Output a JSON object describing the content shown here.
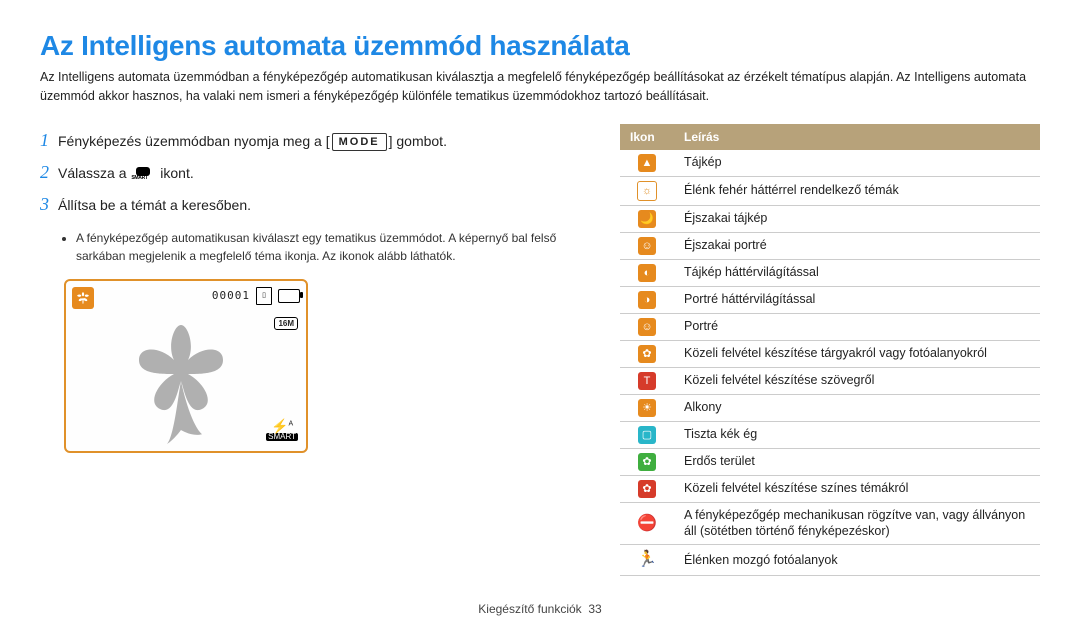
{
  "title": "Az Intelligens automata üzemmód használata",
  "intro": "Az Intelligens automata üzemmódban a fényképezőgép automatikusan kiválasztja a megfelelő fényképezőgép beállításokat az érzékelt tématípus alapján. Az Intelligens automata üzemmód akkor hasznos, ha valaki nem ismeri a fényképezőgép különféle tematikus üzemmódokhoz tartozó beállításait.",
  "steps": {
    "s1_a": "Fényképezés üzemmódban nyomja meg a [",
    "mode": "MODE",
    "s1_b": "] gombot.",
    "s2_a": "Válassza a ",
    "s2_b": " ikont.",
    "s3": "Állítsa be a témát a keresőben."
  },
  "bullet": "A fényképezőgép automatikusan kiválaszt egy tematikus üzemmódot. A képernyő bal felső sarkában megjelenik a megfelelő téma ikonja. Az ikonok alább láthatók.",
  "screen": {
    "counter": "00001",
    "res": "16M",
    "flash_sub": "SMART"
  },
  "th_icon": "Ikon",
  "th_desc": "Leírás",
  "rows": [
    {
      "c": "#e68a1e",
      "sym": "▲",
      "d": "Tájkép"
    },
    {
      "c": "#ffffff",
      "sym": "☼",
      "d": "Élénk fehér háttérrel rendelkező témák",
      "bd": "#e0912a",
      "fg": "#e0912a"
    },
    {
      "c": "#e68a1e",
      "sym": "🌙",
      "d": "Éjszakai tájkép"
    },
    {
      "c": "#e68a1e",
      "sym": "☺",
      "d": "Éjszakai portré"
    },
    {
      "c": "#e68a1e",
      "sym": "◐",
      "d": "Tájkép háttérvilágítással"
    },
    {
      "c": "#e68a1e",
      "sym": "◑",
      "d": "Portré háttérvilágítással"
    },
    {
      "c": "#e68a1e",
      "sym": "☺",
      "d": "Portré"
    },
    {
      "c": "#e68a1e",
      "sym": "✿",
      "d": "Közeli felvétel készítése tárgyakról vagy fotóalanyokról"
    },
    {
      "c": "#d63b2a",
      "sym": "T",
      "d": "Közeli felvétel készítése szövegről"
    },
    {
      "c": "#e68a1e",
      "sym": "☀",
      "d": "Alkony"
    },
    {
      "c": "#29b6c9",
      "sym": "▢",
      "d": "Tiszta kék ég"
    },
    {
      "c": "#3fae3f",
      "sym": "✿",
      "d": "Erdős terület"
    },
    {
      "c": "#d63b2a",
      "sym": "✿",
      "d": "Közeli felvétel készítése színes témákról"
    },
    {
      "c": "",
      "sym": "⛔",
      "d": "A fényképezőgép mechanikusan rögzítve van, vagy állványon áll (sötétben történő fényképezéskor)",
      "plain": true
    },
    {
      "c": "",
      "sym": "🏃",
      "d": "Élénken mozgó fotóalanyok",
      "plain": true
    }
  ],
  "footer_a": "Kiegészítő funkciók",
  "footer_b": "33"
}
